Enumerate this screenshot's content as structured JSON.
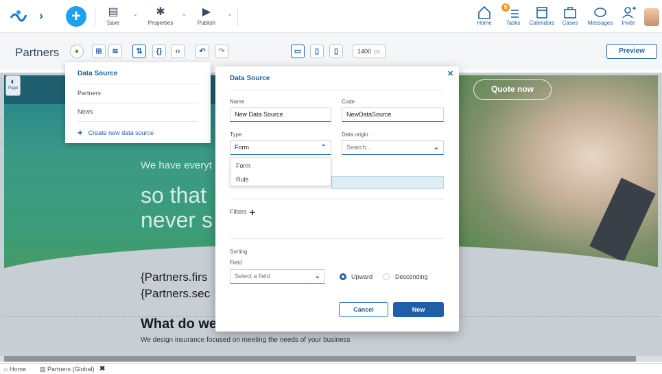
{
  "toolbar": {
    "save": "Save",
    "properties": "Properties",
    "publish": "Publish"
  },
  "nav": {
    "home": "Home",
    "tasks": "Tasks",
    "tasks_badge": "9",
    "calendars": "Calendars",
    "cases": "Cases",
    "messages": "Messages",
    "invite": "Invite"
  },
  "pagebar": {
    "title": "Partners",
    "width_value": "1400",
    "width_unit": "px",
    "preview": "Preview"
  },
  "canvas": {
    "palette_label": "Page",
    "quote_button": "Quote now",
    "hero_line1": "We have everyt",
    "hero_line2": "so that",
    "hero_line3": "never s",
    "merge1": "{Partners.firs",
    "merge2": "{Partners.sec",
    "heading": "What do we",
    "subtext": "We design insurance focused on meeting the needs of your business"
  },
  "ds_menu": {
    "header": "Data Source",
    "items": [
      "Partners",
      "News"
    ],
    "create": "Create new data source"
  },
  "modal": {
    "title": "Data Source",
    "name_label": "Name",
    "name_value": "New Data Source",
    "code_label": "Code",
    "code_value": "NewDataSource",
    "type_label": "Type",
    "type_value": "Form",
    "type_options": [
      "Form",
      "Rule"
    ],
    "origin_label": "Data origin",
    "origin_placeholder": "Search...",
    "filters_label": "Filters",
    "sorting_label": "Sorting",
    "field_label": "Field",
    "field_placeholder": "Select a field",
    "upward": "Upward",
    "descending": "Descending",
    "cancel": "Cancel",
    "new": "New"
  },
  "tabs": {
    "home": "Home",
    "partners": "Partners (Global)"
  },
  "colors": {
    "accent": "#1e5fa8",
    "add_button": "#1da1f2",
    "badge": "#f39c12"
  }
}
